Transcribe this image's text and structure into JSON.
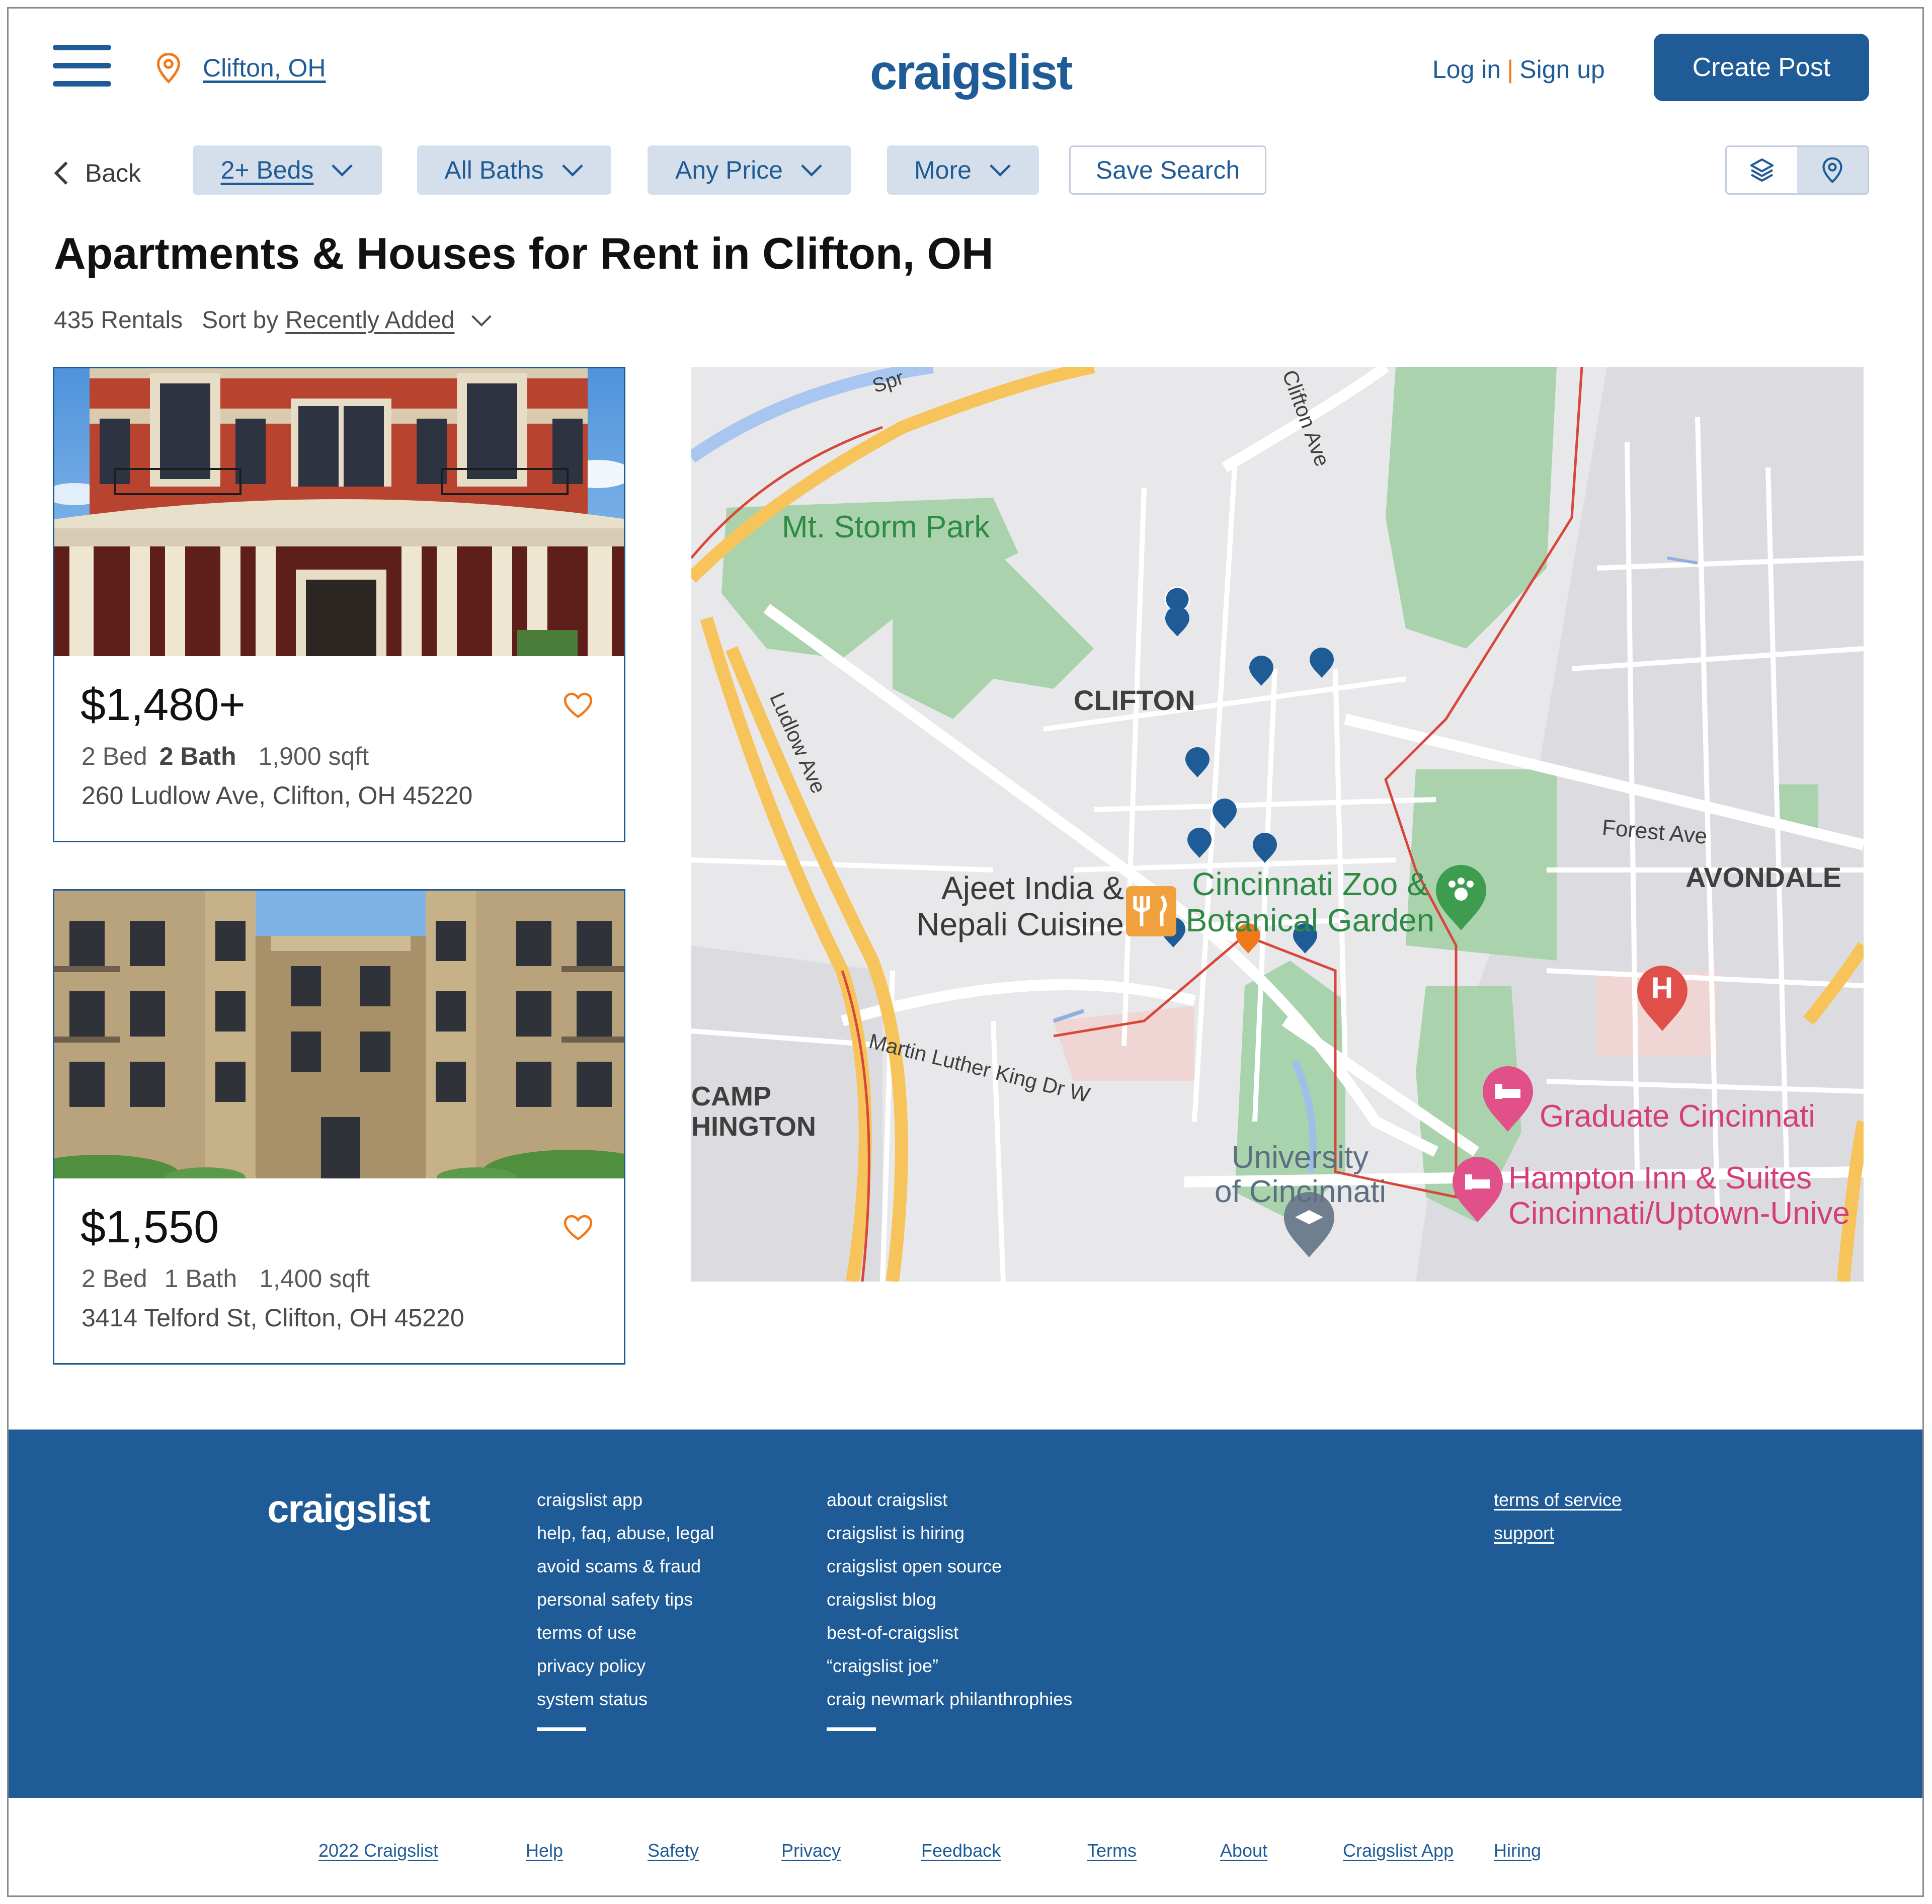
{
  "header": {
    "location": "Clifton, OH",
    "logo": "craigslist",
    "login": "Log in",
    "separator": "|",
    "signup": "Sign up",
    "create_post": "Create Post"
  },
  "filters": {
    "back": "Back",
    "beds": "2+ Beds",
    "baths": "All Baths",
    "price": "Any Price",
    "more": "More",
    "save_search": "Save Search"
  },
  "page": {
    "title": "Apartments & Houses for Rent in Clifton, OH",
    "count": "435 Rentals",
    "sort_label": "Sort by",
    "sort_value": "Recently Added"
  },
  "listings": [
    {
      "price": "$1,480+",
      "beds": "2 Bed",
      "baths": "2 Bath",
      "sqft": "1,900 sqft",
      "address": "260 Ludlow Ave, Clifton, OH 45220"
    },
    {
      "price": "$1,550",
      "beds": "2 Bed",
      "baths": "1 Bath",
      "sqft": "1,400 sqft",
      "address": "3414 Telford St, Clifton, OH 45220"
    }
  ],
  "map": {
    "labels": {
      "park": "Mt. Storm Park",
      "neighborhood": "CLIFTON",
      "ludlow": "Ludlow Ave",
      "clifton_ave": "Clifton Ave",
      "spring": "Spr",
      "restaurant_1": "Ajeet India &",
      "restaurant_2": "Nepali Cuisine",
      "zoo_1": "Cincinnati Zoo &",
      "zoo_2": "Botanical Garden",
      "forest": "Forest Ave",
      "avondale": "AVONDALE",
      "mlk": "Martin Luther King Dr W",
      "camp_1": "CAMP",
      "camp_2": "HINGTON",
      "university_1": "University",
      "university_2": "of Cincinnati",
      "graduate": "Graduate Cincinnati",
      "hampton_1": "Hampton Inn & Suites",
      "hampton_2": "Cincinnati/Uptown-Unive",
      "hospital": "H"
    },
    "colors": {
      "pin": "#1f5b96",
      "selected_pin": "#f07a1b",
      "park": "#aad3ad",
      "highway": "#f6c45a",
      "boundary": "#d9463a"
    }
  },
  "footer": {
    "logo": "craigslist",
    "col1": [
      "craigslist app",
      "help, faq, abuse, legal",
      "avoid scams & fraud",
      "personal safety tips",
      "terms of use",
      "privacy policy",
      "system status"
    ],
    "col2": [
      "about craigslist",
      "craigslist is hiring",
      "craigslist open source",
      "craigslist blog",
      "best-of-craigslist",
      "“craigslist joe”",
      "craig newmark philanthrophies"
    ],
    "col3": [
      "terms of service",
      "support"
    ]
  },
  "bottom_links": [
    "2022 Craigslist",
    "Help",
    "Safety",
    "Privacy",
    "Feedback",
    "Terms",
    "About",
    "Craigslist App",
    "Hiring"
  ],
  "colors": {
    "brand": "#1f5b96",
    "accent": "#f07a1b",
    "chip_bg": "#d5dfeb"
  }
}
